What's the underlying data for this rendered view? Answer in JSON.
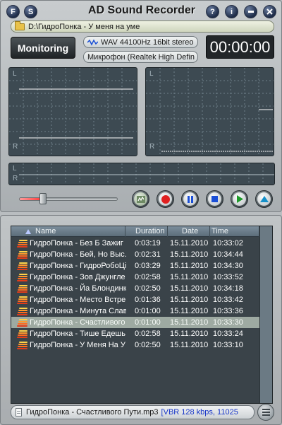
{
  "window": {
    "title": "AD Sound Recorder"
  },
  "title_buttons": {
    "left": [
      "F",
      "S"
    ],
    "right": [
      "?",
      "i"
    ]
  },
  "path": "D:\\ГидроПонка - У меня на уме",
  "monitoring_label": "Monitoring",
  "format": "WAV 44100Hz 16bit stereo",
  "device": "Микрофон (Realtek High Defin",
  "timer": "00:00:00",
  "channels": {
    "left": "L",
    "right": "R"
  },
  "volume": {
    "level": 0.22
  },
  "list": {
    "columns": {
      "name": "Name",
      "duration": "Duration",
      "date": "Date",
      "time": "Time"
    },
    "rows": [
      {
        "name": "ГидроПонка - Без Б Зажиг",
        "duration": "0:03:19",
        "date": "15.11.2010",
        "time": "10:33:02"
      },
      {
        "name": "ГидроПонка - Бей, Но Выс.",
        "duration": "0:02:31",
        "date": "15.11.2010",
        "time": "10:34:44"
      },
      {
        "name": "ГидроПонка - ГидроРобоЦі",
        "duration": "0:03:29",
        "date": "15.11.2010",
        "time": "10:34:30"
      },
      {
        "name": "ГидроПонка - Зов Джунгле",
        "duration": "0:02:58",
        "date": "15.11.2010",
        "time": "10:33:52"
      },
      {
        "name": "ГидроПонка - Йа Блондинк",
        "duration": "0:02:50",
        "date": "15.11.2010",
        "time": "10:34:18"
      },
      {
        "name": "ГидроПонка - Место Встре",
        "duration": "0:01:36",
        "date": "15.11.2010",
        "time": "10:33:42"
      },
      {
        "name": "ГидроПонка - Минута Слав",
        "duration": "0:01:00",
        "date": "15.11.2010",
        "time": "10:33:36"
      },
      {
        "name": "ГидроПонка - Счастливого",
        "duration": "0:01:00",
        "date": "15.11.2010",
        "time": "10:33:30"
      },
      {
        "name": "ГидроПонка - Тише Едешь,",
        "duration": "0:02:58",
        "date": "15.11.2010",
        "time": "10:33:24"
      },
      {
        "name": "ГидроПонка - У Меня На У",
        "duration": "0:02:50",
        "date": "15.11.2010",
        "time": "10:33:10"
      }
    ],
    "selected_index": 7
  },
  "status": {
    "file": "ГидроПонка - Счастливого Пути.mp3",
    "info": "[VBR 128 kbps, 11025"
  },
  "colors": {
    "record": "#e02020",
    "pause_stop": "#1a4fd6",
    "play": "#1d9a2a",
    "eject": "#1590c9"
  },
  "icons": {
    "controls": [
      "mixer-icon",
      "record-icon",
      "pause-icon",
      "stop-icon",
      "play-icon",
      "eject-icon"
    ]
  }
}
